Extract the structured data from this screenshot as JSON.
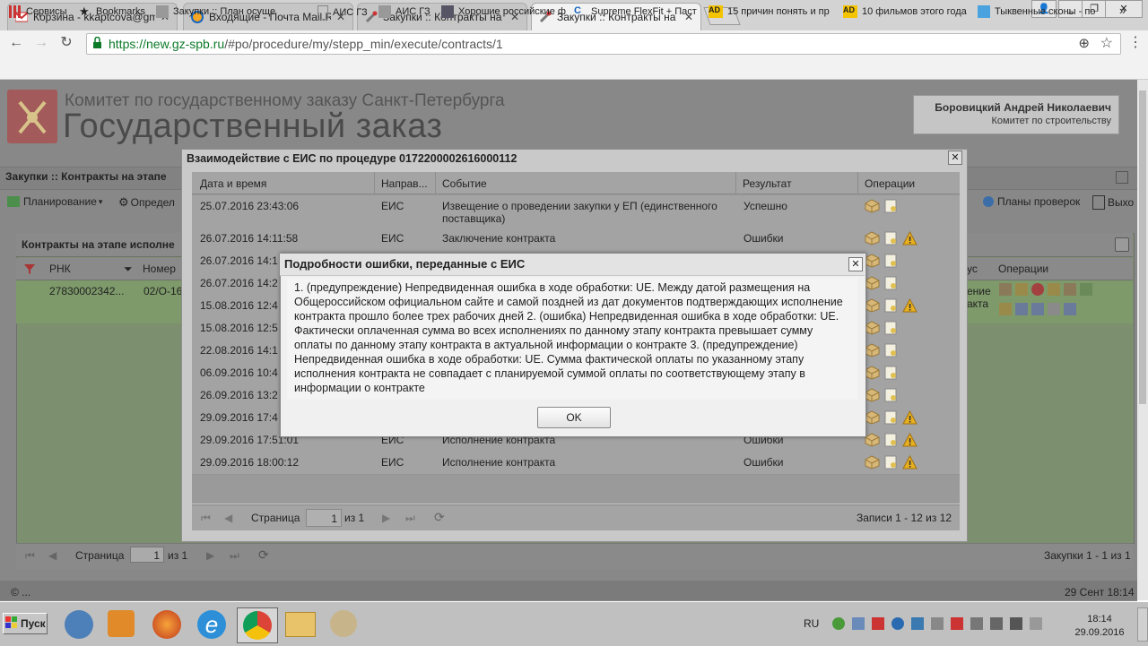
{
  "browser": {
    "tabs": [
      {
        "title": "Корзина - kkaptcova@gma",
        "icon": "gmail-icon",
        "active": false
      },
      {
        "title": "Входящие - Почта Mail.Ru",
        "icon": "mailru-icon",
        "active": false
      },
      {
        "title": "Закупки :: Контракты на э",
        "icon": "tools-icon",
        "active": false
      },
      {
        "title": "Закупки :: Контракты на э",
        "icon": "tools-icon",
        "active": true
      }
    ],
    "url_host": "https://new.gz-spb.ru",
    "url_path": "/#po/procedure/my/stepp_min/execute/contracts/1",
    "bookmarks": [
      "Сервисы",
      "Bookmarks",
      "Закупки :: План осуще",
      "АИС ГЗ",
      "АИС ГЗ",
      "Хорошие российские ф",
      "Supreme FlexFit + Паст",
      "15 причин понять и пр",
      "10 фильмов этого года",
      "Тыквенные сконы - по"
    ],
    "more": "»"
  },
  "site": {
    "title_small": "Комитет по государственному заказу Санкт-Петербурга",
    "title_big": "Государственный заказ",
    "user_name": "Боровицкий Андрей Николаевич",
    "user_org": "Комитет по строительству",
    "section_title": "Закупки :: Контракты на этапе",
    "menu_planning": "Планирование",
    "menu_define": "Определ",
    "menu_checks": "Планы проверок",
    "menu_exit": "Выхо",
    "panel_title": "Контракты на этапе исполне",
    "col_rnk": "РНК",
    "col_num": "Номер",
    "col_status": "ус",
    "col_ops": "Операции",
    "row_rnk": "27830002342...",
    "row_num": "02/О-16",
    "row_ops_text1": "ение",
    "row_ops_text2": "акта",
    "pager_label": "Страница",
    "pager_value": "1",
    "pager_of": "из 1",
    "pager_count": "Закупки 1 - 1 из 1",
    "copyright": "© ...",
    "datetime": "29 Сент 18:14"
  },
  "dialog1": {
    "title": "Взаимодействие с ЕИС по процедуре 0172200002616000112",
    "columns": [
      "Дата и время",
      "Направ...",
      "Событие",
      "Результат",
      "Операции"
    ],
    "rows": [
      {
        "date": "25.07.2016 23:43:06",
        "dir": "ЕИС",
        "event": "Извещение о проведении закупки у ЕП (единственного поставщика)",
        "result": "Успешно",
        "warn": false
      },
      {
        "date": "26.07.2016 14:11:58",
        "dir": "ЕИС",
        "event": "Заключение контракта",
        "result": "Ошибки",
        "warn": true
      },
      {
        "date": "26.07.2016 14:1",
        "dir": "",
        "event": "",
        "result": "",
        "warn": false
      },
      {
        "date": "26.07.2016 14:2",
        "dir": "",
        "event": "",
        "result": "",
        "warn": false
      },
      {
        "date": "15.08.2016 12:4",
        "dir": "",
        "event": "",
        "result": "",
        "warn": true
      },
      {
        "date": "15.08.2016 12:5",
        "dir": "",
        "event": "",
        "result": "",
        "warn": false
      },
      {
        "date": "22.08.2016 14:1",
        "dir": "",
        "event": "",
        "result": "",
        "warn": false
      },
      {
        "date": "06.09.2016 10:4",
        "dir": "",
        "event": "",
        "result": "",
        "warn": false
      },
      {
        "date": "26.09.2016 13:2",
        "dir": "",
        "event": "",
        "result": "",
        "warn": false
      },
      {
        "date": "29.09.2016 17:4",
        "dir": "",
        "event": "",
        "result": "",
        "warn": true
      },
      {
        "date": "29.09.2016 17:51:01",
        "dir": "ЕИС",
        "event": "Исполнение контракта",
        "result": "Ошибки",
        "warn": true
      },
      {
        "date": "29.09.2016 18:00:12",
        "dir": "ЕИС",
        "event": "Исполнение контракта",
        "result": "Ошибки",
        "warn": true
      }
    ],
    "pager_label": "Страница",
    "pager_value": "1",
    "pager_of": "из 1",
    "records": "Записи 1 - 12 из 12"
  },
  "dialog2": {
    "title": "Подробности ошибки, переданные с ЕИС",
    "message": "1. (предупреждение) Непредвиденная ошибка в ходе обработки: UE. Между датой размещения на Общероссийском официальном сайте и самой поздней из дат документов подтверждающих исполнение контракта прошло более трех рабочих дней 2. (ошибка) Непредвиденная ошибка в ходе обработки: UE. Фактически оплаченная сумма во всех исполнениях по данному этапу контракта превышает сумму оплаты по данному этапу контракта в актуальной информации о контракте 3. (предупреждение) Непредвиденная ошибка в ходе обработки: UE. Сумма фактической оплаты по указанному этапу исполнения контракта не совпадает с планируемой суммой оплаты по соответствующему этапу в информации о контракте",
    "ok": "OK"
  },
  "taskbar": {
    "start": "Пуск",
    "lang": "RU",
    "time": "18:14",
    "date": "29.09.2016"
  }
}
